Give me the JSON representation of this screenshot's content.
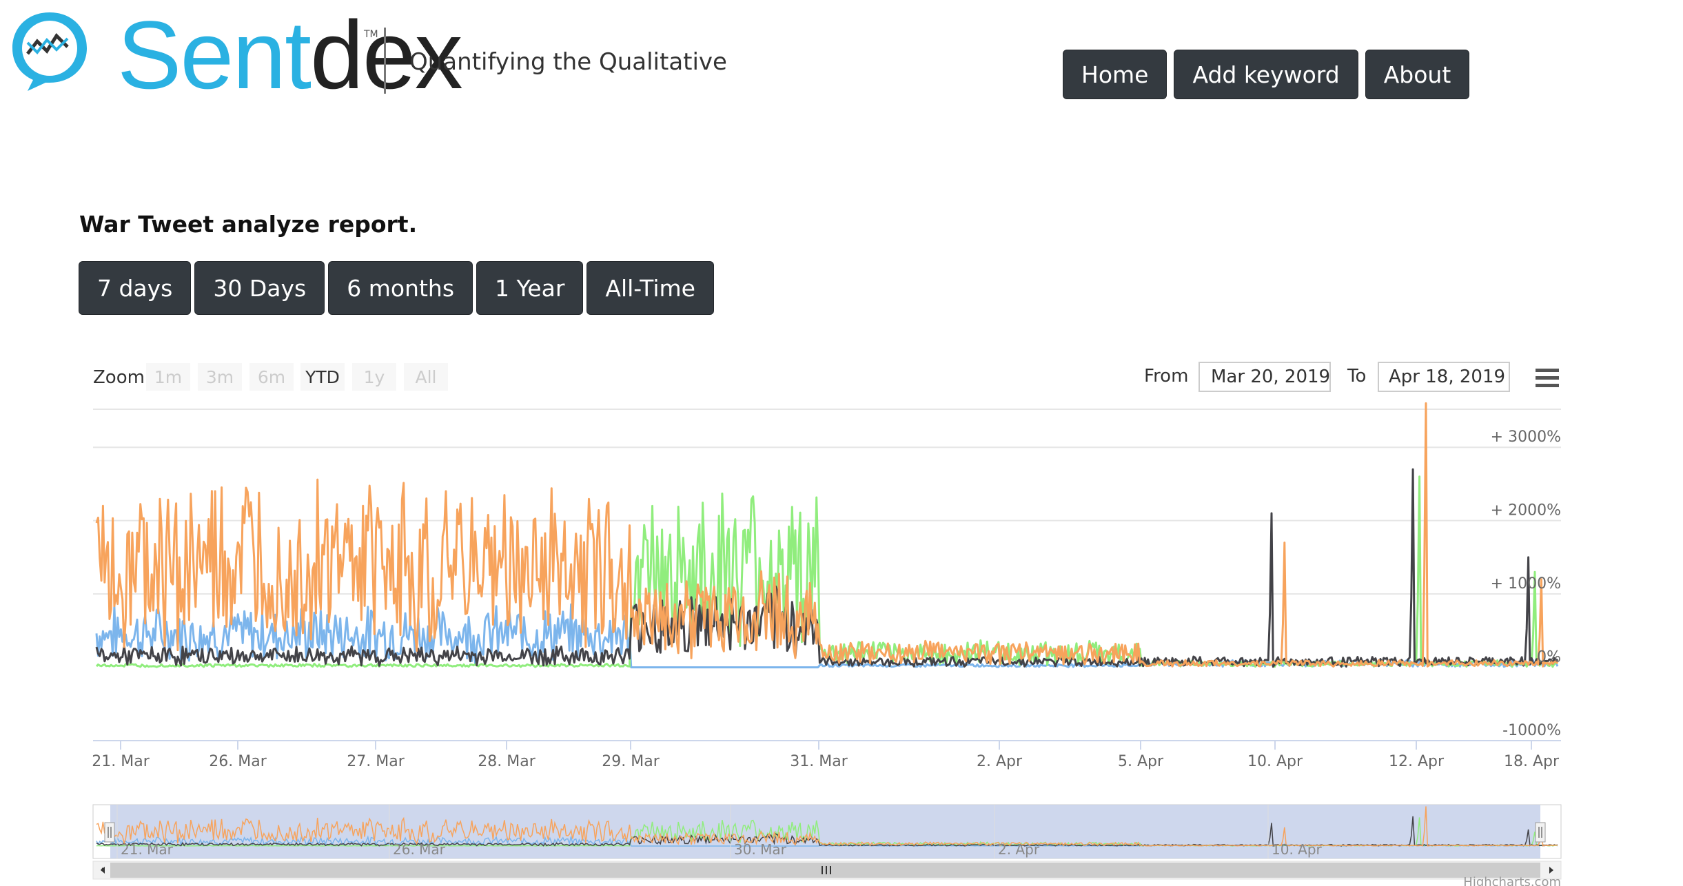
{
  "header": {
    "brand_part1": "Sent",
    "brand_part2": "dex",
    "trademark": "TM",
    "tagline": "Quantifying the Qualitative",
    "nav": [
      "Home",
      "Add keyword",
      "About"
    ]
  },
  "report": {
    "title": "War Tweet analyze report.",
    "ranges": [
      "7 days",
      "30 Days",
      "6 months",
      "1 Year",
      "All-Time"
    ]
  },
  "toolbar": {
    "zoom_label": "Zoom",
    "zoom_buttons": [
      {
        "label": "1m",
        "enabled": false
      },
      {
        "label": "3m",
        "enabled": false
      },
      {
        "label": "6m",
        "enabled": false
      },
      {
        "label": "YTD",
        "enabled": true
      },
      {
        "label": "1y",
        "enabled": false
      },
      {
        "label": "All",
        "enabled": false
      }
    ],
    "from_label": "From",
    "from_value": "Mar 20, 2019",
    "to_label": "To",
    "to_value": "Apr 18, 2019",
    "menu_icon": "hamburger-menu-icon"
  },
  "chart_data": {
    "type": "line",
    "title": "",
    "xlabel": "",
    "ylabel": "",
    "ylim": [
      -1000,
      3500
    ],
    "y_ticks": [
      "+ 3000%",
      "+ 2000%",
      "+ 1000%",
      "0%",
      "-1000%"
    ],
    "y_tick_values": [
      3000,
      2000,
      1000,
      0,
      -1000
    ],
    "x_tick_labels": [
      "21. Mar",
      "26. Mar",
      "27. Mar",
      "28. Mar",
      "29. Mar",
      "31. Mar",
      "2. Apr",
      "5. Apr",
      "10. Apr",
      "12. Apr",
      "18. Apr"
    ],
    "navigator_labels": [
      "21. Mar",
      "26. Mar",
      "30. Mar",
      "2. Apr",
      "10. Apr"
    ],
    "colors": [
      "#7cb5ec",
      "#434348",
      "#90ed7d",
      "#f7a35c"
    ],
    "grid": true,
    "legend": "none",
    "segments": [
      {
        "x_range": [
          "21. Mar",
          "29. Mar"
        ],
        "approx_mean": {
          "series1": 350,
          "series2": 120,
          "series3": 20,
          "series4": 1050
        }
      },
      {
        "x_range": [
          "29. Mar",
          "31. Mar"
        ],
        "approx_mean": {
          "series1": 0,
          "series2": 450,
          "series3": 1000,
          "series4": 550
        }
      },
      {
        "x_range": [
          "31. Mar",
          "5. Apr"
        ],
        "approx_mean": {
          "series1": 20,
          "series2": 60,
          "series3": 150,
          "series4": 150
        }
      }
    ],
    "peaks": [
      {
        "series": "series2",
        "x": "10. Apr",
        "y": 2100
      },
      {
        "series": "series4",
        "x": "10. Apr",
        "y": 1700
      },
      {
        "series": "series2",
        "x": "12. Apr",
        "y": 2700
      },
      {
        "series": "series4",
        "x": "12. Apr",
        "y": 3600
      },
      {
        "series": "series3",
        "x": "12. Apr",
        "y": 2600
      },
      {
        "series": "series2",
        "x": "18. Apr",
        "y": 1500
      },
      {
        "series": "series3",
        "x": "18. Apr",
        "y": 1300
      },
      {
        "series": "series4",
        "x": "18. Apr",
        "y": 1200
      }
    ],
    "credits": "Highcharts.com"
  }
}
